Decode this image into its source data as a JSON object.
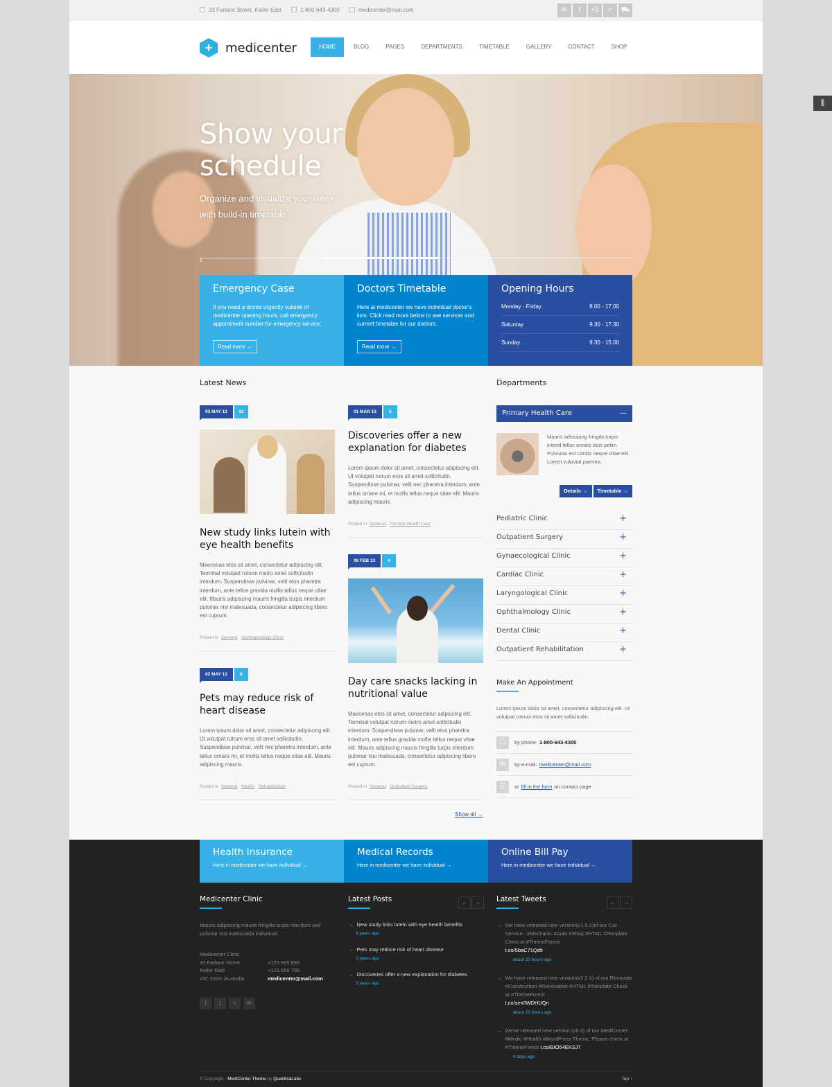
{
  "topbar": {
    "address": "33 Farlane Street, Keilor East",
    "phone": "1-800-643-4300",
    "email": "medicenter@mail.com",
    "social_icons": [
      "envelope-icon",
      "facebook-icon",
      "google-plus-icon",
      "skype-icon",
      "cart-icon"
    ]
  },
  "header": {
    "logo_text": "medicenter",
    "nav": [
      "HOME",
      "BLOG",
      "PAGES",
      "DEPARTMENTS",
      "TIMETABLE",
      "GALLERY",
      "CONTACT",
      "SHOP"
    ],
    "active_nav": "HOME"
  },
  "hero": {
    "title_line1": "Show your",
    "title_line2": "schedule",
    "subtitle_line1": "Organize and visualize your week",
    "subtitle_line2": "with build-in timetable",
    "slide_number": "1",
    "slide_progress_percent": 26
  },
  "feature_boxes": [
    {
      "title": "Emergency Case",
      "text": "If you need a doctor urgently outside of medicenter opening hours, call emergency appointment number for emergency service.",
      "button": "Read more →",
      "color": "#37b1e6"
    },
    {
      "title": "Doctors Timetable",
      "text": "Here at medicenter we have individual doctor's lists. Click read more below to see services and current timetable for our doctors.",
      "button": "Read more →",
      "color": "#0384ce"
    },
    {
      "title": "Opening Hours",
      "color": "#2a4ea0",
      "hours": [
        {
          "day": "Monday - Friday",
          "time": "8.00 - 17.00"
        },
        {
          "day": "Saturday",
          "time": "9.30 - 17.30"
        },
        {
          "day": "Sunday",
          "time": "9.30 - 15.00"
        }
      ]
    }
  ],
  "news": {
    "title": "Latest News",
    "posted_in_label": "Posted in",
    "show_all": "Show all →",
    "posts": [
      {
        "date": "03 MAY 13",
        "comments": "13",
        "title": "New study links lutein with eye health benefits",
        "text": "Maecenas etos sit amet, consectetur adipiscing elit. Terminal volutpat rutrum metro amet sollicitudin interdum. Suspendisse pulvinar, velit etos pharetra interdum, ante tellus gravida mollis tellus neque vitae elit. Mauris adipiscing mauris fringilla turpis interdum pulvinar nisi malesuada, consectetur adipiscing libero est cuprum.",
        "categories": [
          "General",
          "Ophthalmology Clinic"
        ]
      },
      {
        "date": "01 MAR 13",
        "comments": "5",
        "title": "Discoveries offer a new explanation for diabetes",
        "text": "Lorem ipsum dolor sit amet, consectetur adipiscing elit. Ut volutpat rutrum eros sit amet sollicitudin. Suspendisse pulvinar, velit nec pharetra interdum, ante tellus ornare mi, et mollis tellus neque vitae elit. Mauris adipiscing mauris.",
        "categories": [
          "General",
          "Primary Health Care"
        ]
      },
      {
        "date": "02 MAY 13",
        "comments": "6",
        "title": "Pets may reduce risk of heart disease",
        "text": "Lorem ipsum dolor sit amet, consectetur adipiscing elit. Ut volutpat rutrum eros sit amet sollicitudin. Suspendisse pulvinar, velit nec pharetra interdum, ante tellus ornare mi, et mollis tellus neque vitae elit. Mauris adipiscing mauris.",
        "categories": [
          "General",
          "Health",
          "Rehabilitation"
        ]
      },
      {
        "date": "08 FEB 13",
        "comments": "4",
        "title": "Day care snacks lacking in nutritional value",
        "text": "Maecenas etos sit amet, consectetur adipiscing elit. Terminal volutpat rutrum metro amet sollicitudin interdum. Suspendisse pulvinar, velit etos pharetra interdum, ante tellus gravida mollis tellus neque vitae elit. Mauris adipiscing mauris fringilla turpis interdum pulvinar nisi malesuada, consectetur adipiscing libero est cuprum.",
        "categories": [
          "General",
          "Outpatient Surgery"
        ]
      }
    ]
  },
  "departments": {
    "title": "Departments",
    "open": {
      "name": "Primary Health Care",
      "toggle": "—",
      "text": "Mauris adisciping fringila turpis intend tellus ornare etos pelim. Pulvunar est cardio neque vitae elit. Lorem vulputat paentra.",
      "details": "Details →",
      "timetable": "Timetable →"
    },
    "items": [
      "Pediatric Clinic",
      "Outpatient Surgery",
      "Gynaecological Clinic",
      "Cardiac Clinic",
      "Laryngological Clinic",
      "Ophthalmology Clinic",
      "Dental Clinic",
      "Outpatient Rehabilitation"
    ],
    "plus": "+"
  },
  "appointment": {
    "title": "Make An Appointment",
    "text": "Lorem ipsum dolor sit amet, consectetur adipiscing elit. Ut volutpat rutrum eros sit amet sollicitudin.",
    "phone_label": "by phone:",
    "phone": "1-800-643-4300",
    "email_label": "by e-mail:",
    "email": "medicenter@mail.com",
    "form_pre": "or",
    "form_link": "fill in the form",
    "form_post": "on contact page"
  },
  "footer_boxes": [
    {
      "title": "Health Insurance",
      "text": "Here in medicenter we have individual  →",
      "color": "#37b1e6"
    },
    {
      "title": "Medical Records",
      "text": "Here in medicenter we have individual  →",
      "color": "#0384ce"
    },
    {
      "title": "Online Bill Pay",
      "text": "Here in medicenter we have individual  →",
      "color": "#2a4ea0"
    }
  ],
  "footer": {
    "clinic": {
      "title": "Medicenter Clinic",
      "text": "Mauris adipiscing mauris fringilla turpis interdum sed pulvinar nisi malesuada individual.",
      "address": [
        "Medicenter Clinic",
        "33 Farlane Street",
        "Keilor East",
        "VIC 3033, Australia"
      ],
      "phones": [
        "+123 655 655",
        "+123 655 755"
      ],
      "email": "medicenter@mail.com",
      "social": [
        "facebook-icon",
        "twitter-icon",
        "google-plus-icon",
        "envelope-icon"
      ]
    },
    "posts": {
      "title": "Latest Posts",
      "items": [
        {
          "title": "New study links lutein with eye health benefits",
          "time": "3 years ago"
        },
        {
          "title": "Pets may reduce risk of heart disease",
          "time": "3 years ago"
        },
        {
          "title": "Discoveries offer a new explanation for diabetes",
          "time": "3 years ago"
        }
      ]
    },
    "tweets": {
      "title": "Latest Tweets",
      "items": [
        {
          "text": "We have released new version(v1.5.1)of our Car Service - #Mechanic #Auto #Shop #HTML #Template Chect at #ThemeForest",
          "link": "t.co/5baC71Qdti",
          "time": "about 23 hours ago"
        },
        {
          "text": "We have released new version(v2.2.1) of our Renovate #Construction #Renovation #HTML #Template Check at #ThemeForest",
          "link": "t.co/sex0WDHUQn",
          "time": "about 23 hours ago"
        },
        {
          "text": "We've released new version (v8.3) of our MediCenter #Medic #Health #WordPress Theme. Please check at #ThemeForest",
          "link": "t.co/BIO54EKSJ7",
          "time": "4 days ago"
        }
      ]
    },
    "arrows": {
      "prev": "←",
      "next": "→"
    },
    "copyright_pre": "© Copyright -",
    "copyright_theme": "MediCenter Theme",
    "copyright_by": "by",
    "copyright_author": "QuanticaLabs",
    "top_label": "Top  ↑"
  }
}
